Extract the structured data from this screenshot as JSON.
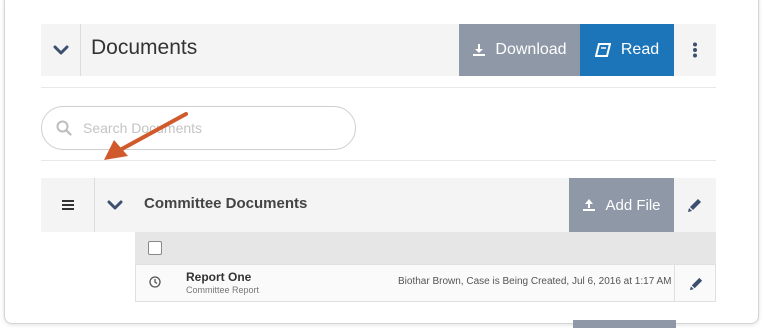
{
  "header": {
    "title": "Documents",
    "download_label": "Download",
    "read_label": "Read"
  },
  "search": {
    "placeholder": "Search Documents"
  },
  "folder": {
    "title": "Committee Documents",
    "add_file_label": "Add File"
  },
  "documents": [
    {
      "name": "Report One",
      "type": "Committee Report",
      "meta": "Biothar Brown, Case is Being Created, Jul 6, 2016 at 1:17 AM"
    }
  ],
  "icons": {
    "collapse": "chevron-down-icon",
    "download": "download-icon",
    "read": "book-icon",
    "more": "vertical-dots-icon",
    "search": "search-icon",
    "menu": "hamburger-icon",
    "upload": "upload-icon",
    "edit": "pencil-icon",
    "clock": "clock-icon",
    "annotation": "arrow-icon"
  },
  "colors": {
    "read_button": "#1c75b9",
    "grey_button": "#8e98a6",
    "chevron": "#3d4f6e",
    "annotation_arrow": "#d05a2c"
  }
}
